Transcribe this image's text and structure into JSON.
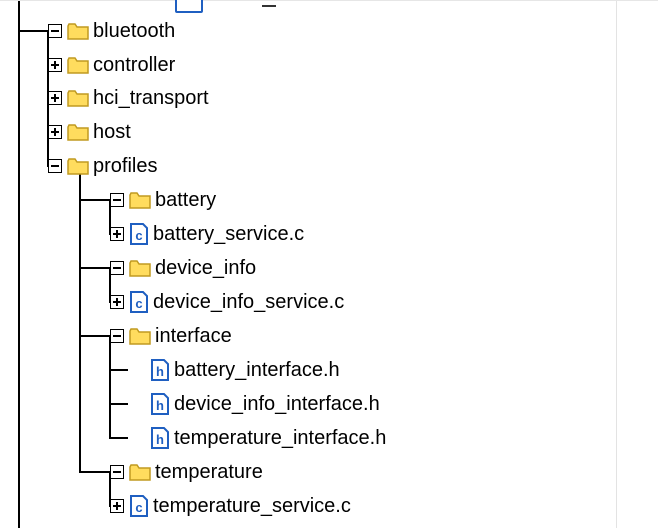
{
  "tree": {
    "nodes": [
      {
        "label": "bluetooth",
        "type": "folder",
        "expander": "minus"
      },
      {
        "label": "controller",
        "type": "folder",
        "expander": "plus"
      },
      {
        "label": "hci_transport",
        "type": "folder",
        "expander": "plus"
      },
      {
        "label": "host",
        "type": "folder",
        "expander": "plus"
      },
      {
        "label": "profiles",
        "type": "folder",
        "expander": "minus"
      },
      {
        "label": "battery",
        "type": "folder",
        "expander": "minus"
      },
      {
        "label": "battery_service.c",
        "type": "c-file",
        "expander": "plus",
        "icon_letter": "c"
      },
      {
        "label": "device_info",
        "type": "folder",
        "expander": "minus"
      },
      {
        "label": "device_info_service.c",
        "type": "c-file",
        "expander": "plus",
        "icon_letter": "c"
      },
      {
        "label": "interface",
        "type": "folder",
        "expander": "minus"
      },
      {
        "label": "battery_interface.h",
        "type": "h-file",
        "expander": "none",
        "icon_letter": "h"
      },
      {
        "label": "device_info_interface.h",
        "type": "h-file",
        "expander": "none",
        "icon_letter": "h"
      },
      {
        "label": "temperature_interface.h",
        "type": "h-file",
        "expander": "none",
        "icon_letter": "h"
      },
      {
        "label": "temperature",
        "type": "folder",
        "expander": "minus"
      },
      {
        "label": "temperature_service.c",
        "type": "c-file",
        "expander": "plus",
        "icon_letter": "c"
      }
    ]
  },
  "colors": {
    "folder_fill": "#ffdc5e",
    "folder_stroke": "#c09a20",
    "file_stroke": "#1f5fc1",
    "line": "#000000"
  }
}
